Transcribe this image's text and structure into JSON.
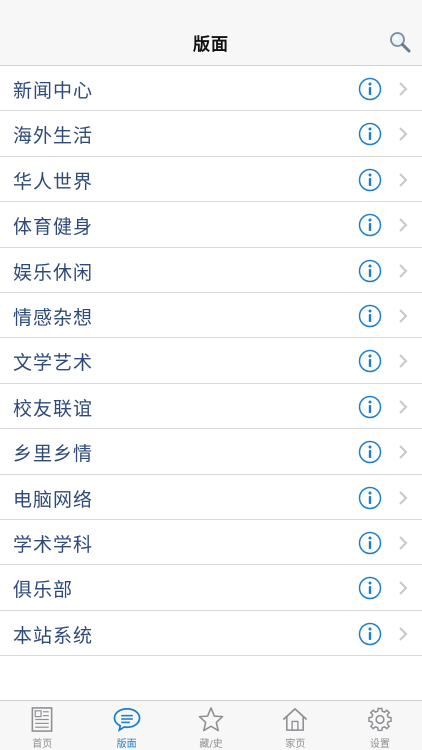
{
  "navbar": {
    "title": "版面",
    "search_icon": "search-icon"
  },
  "colors": {
    "accent": "#1a7fd0",
    "row_text": "#2e4a78",
    "tab_inactive": "#8e8e93",
    "chevron": "#c7c7cc"
  },
  "list": {
    "items": [
      {
        "label": "新闻中心"
      },
      {
        "label": "海外生活"
      },
      {
        "label": "华人世界"
      },
      {
        "label": "体育健身"
      },
      {
        "label": "娱乐休闲"
      },
      {
        "label": "情感杂想"
      },
      {
        "label": "文学艺术"
      },
      {
        "label": "校友联谊"
      },
      {
        "label": "乡里乡情"
      },
      {
        "label": "电脑网络"
      },
      {
        "label": "学术学科"
      },
      {
        "label": "俱乐部"
      },
      {
        "label": "本站系统"
      }
    ]
  },
  "tabbar": {
    "tabs": [
      {
        "label": "首页",
        "icon": "newspaper-icon",
        "active": false
      },
      {
        "label": "版面",
        "icon": "chat-bubble-icon",
        "active": true
      },
      {
        "label": "藏/史",
        "icon": "star-icon",
        "active": false
      },
      {
        "label": "家页",
        "icon": "home-icon",
        "active": false
      },
      {
        "label": "设置",
        "icon": "gear-icon",
        "active": false
      }
    ]
  }
}
